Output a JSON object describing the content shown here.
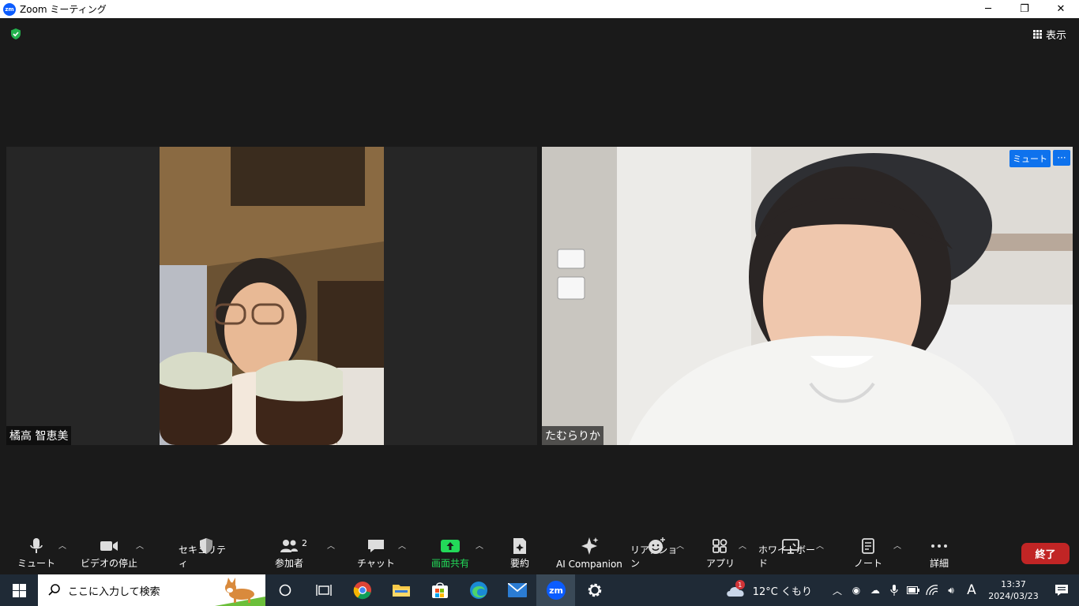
{
  "window": {
    "logo_text": "zm",
    "title": "Zoom ミーティング",
    "minimize": "─",
    "restore": "❐",
    "close": "✕"
  },
  "meeting": {
    "view_label": "表示",
    "participants": [
      {
        "name": "橘高 智恵美"
      },
      {
        "name": "たむらりか",
        "mute_label": "ミュート",
        "more_label": "···"
      }
    ]
  },
  "toolbar": {
    "mute": "ミュート",
    "video": "ビデオの停止",
    "security": "セキュリティ",
    "participants": "参加者",
    "participant_count": "2",
    "chat": "チャット",
    "share": "画面共有",
    "summary": "要約",
    "ai": "AI Companion",
    "reactions": "リアクション",
    "apps": "アプリ",
    "whiteboard": "ホワイトボード",
    "notes": "ノート",
    "more": "詳細",
    "end": "終了",
    "share_color": "#23d959",
    "end_color": "#c12525"
  },
  "taskbar": {
    "search_placeholder": "ここに入力して検索",
    "weather_badge": "1",
    "weather": "12°C くもり",
    "ime": "A",
    "time": "13:37",
    "date": "2024/03/23"
  }
}
